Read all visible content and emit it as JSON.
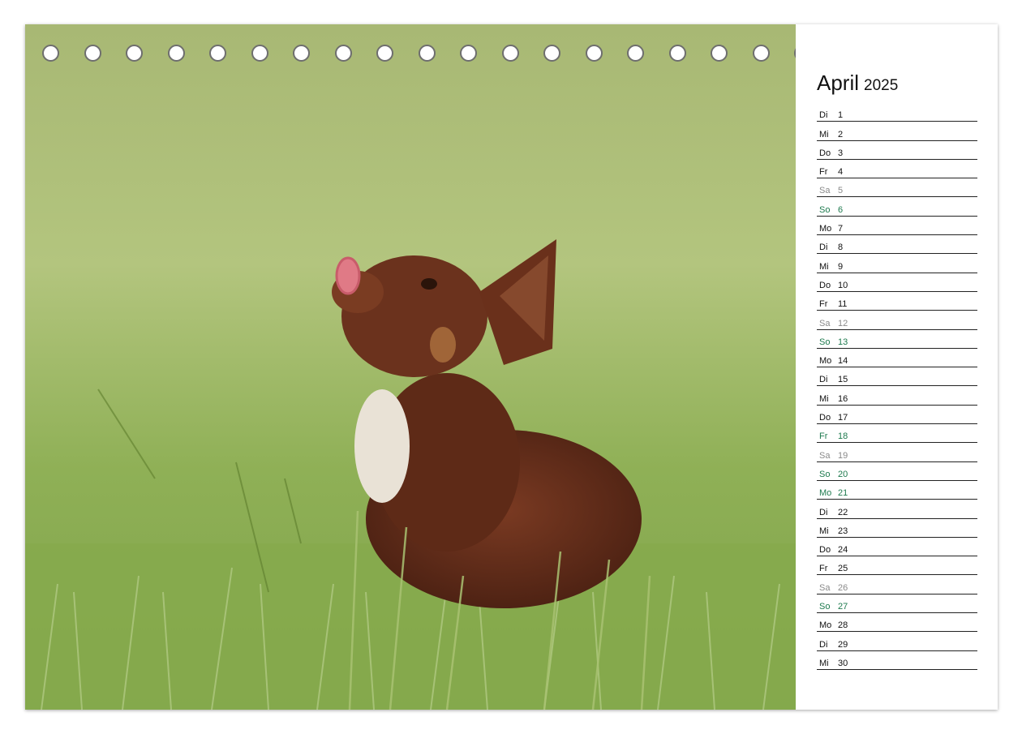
{
  "calendar": {
    "month": "April",
    "year": "2025",
    "days": [
      {
        "weekday": "Di",
        "day": "1",
        "type": "weekday"
      },
      {
        "weekday": "Mi",
        "day": "2",
        "type": "weekday"
      },
      {
        "weekday": "Do",
        "day": "3",
        "type": "weekday"
      },
      {
        "weekday": "Fr",
        "day": "4",
        "type": "weekday"
      },
      {
        "weekday": "Sa",
        "day": "5",
        "type": "sat"
      },
      {
        "weekday": "So",
        "day": "6",
        "type": "sun"
      },
      {
        "weekday": "Mo",
        "day": "7",
        "type": "weekday"
      },
      {
        "weekday": "Di",
        "day": "8",
        "type": "weekday"
      },
      {
        "weekday": "Mi",
        "day": "9",
        "type": "weekday"
      },
      {
        "weekday": "Do",
        "day": "10",
        "type": "weekday"
      },
      {
        "weekday": "Fr",
        "day": "11",
        "type": "weekday"
      },
      {
        "weekday": "Sa",
        "day": "12",
        "type": "sat"
      },
      {
        "weekday": "So",
        "day": "13",
        "type": "sun"
      },
      {
        "weekday": "Mo",
        "day": "14",
        "type": "weekday"
      },
      {
        "weekday": "Di",
        "day": "15",
        "type": "weekday"
      },
      {
        "weekday": "Mi",
        "day": "16",
        "type": "weekday"
      },
      {
        "weekday": "Do",
        "day": "17",
        "type": "weekday"
      },
      {
        "weekday": "Fr",
        "day": "18",
        "type": "hol"
      },
      {
        "weekday": "Sa",
        "day": "19",
        "type": "sat"
      },
      {
        "weekday": "So",
        "day": "20",
        "type": "sun"
      },
      {
        "weekday": "Mo",
        "day": "21",
        "type": "hol"
      },
      {
        "weekday": "Di",
        "day": "22",
        "type": "weekday"
      },
      {
        "weekday": "Mi",
        "day": "23",
        "type": "weekday"
      },
      {
        "weekday": "Do",
        "day": "24",
        "type": "weekday"
      },
      {
        "weekday": "Fr",
        "day": "25",
        "type": "weekday"
      },
      {
        "weekday": "Sa",
        "day": "26",
        "type": "sat"
      },
      {
        "weekday": "So",
        "day": "27",
        "type": "sun"
      },
      {
        "weekday": "Mo",
        "day": "28",
        "type": "weekday"
      },
      {
        "weekday": "Di",
        "day": "29",
        "type": "weekday"
      },
      {
        "weekday": "Mi",
        "day": "30",
        "type": "weekday"
      }
    ]
  },
  "colors": {
    "weekday": "#111111",
    "saturday": "#8a8a8a",
    "sunday_holiday": "#1e7a4e",
    "grass": "#9eb86a",
    "puppy": "#5a2a17"
  },
  "binding": {
    "hole_count": 23
  }
}
